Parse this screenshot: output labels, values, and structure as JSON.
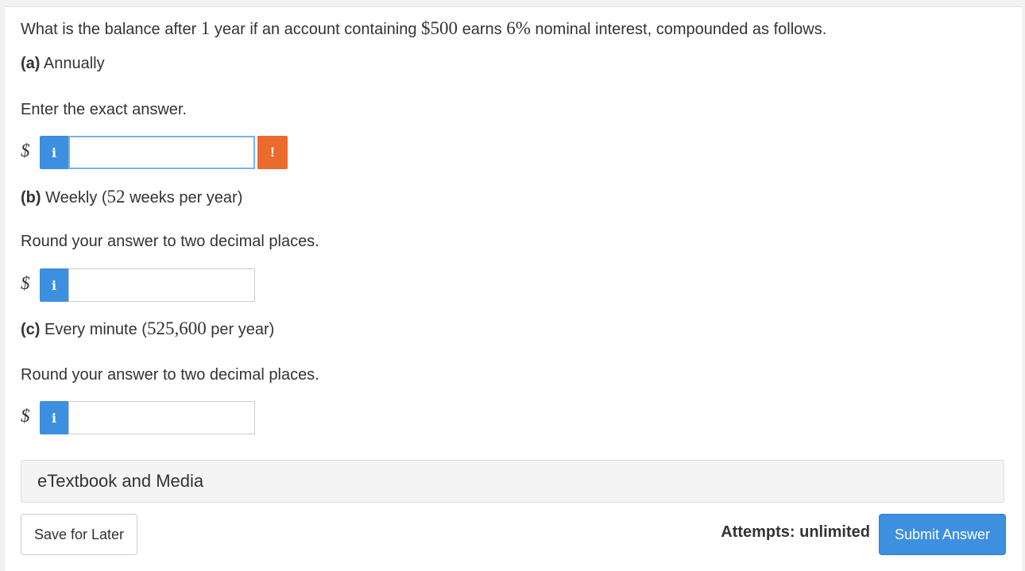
{
  "question": {
    "intro": {
      "pre1": "What is the balance after ",
      "years": "1",
      "pre2": " year if an account containing ",
      "principal": "$500",
      "pre3": " earns ",
      "rate": "6%",
      "post": " nominal interest, compounded as follows."
    }
  },
  "parts": [
    {
      "tag": "(a)",
      "label": "Annually",
      "instruction": "Enter the exact answer.",
      "currency": "$",
      "info_icon": "i",
      "value": "",
      "warning_icon": "!"
    },
    {
      "tag": "(b)",
      "label_pre": "Weekly (",
      "label_math": "52",
      "label_post": " weeks per year)",
      "instruction": "Round your answer to two decimal places.",
      "currency": "$",
      "info_icon": "i",
      "value": ""
    },
    {
      "tag": "(c)",
      "label_pre": "Every minute (",
      "label_math": "525,600",
      "label_post": " per year)",
      "instruction": "Round your answer to two decimal places.",
      "currency": "$",
      "info_icon": "i",
      "value": ""
    }
  ],
  "etextbook": {
    "label": "eTextbook and Media"
  },
  "footer": {
    "save_label": "Save for Later",
    "attempts_label": "Attempts: unlimited",
    "submit_label": "Submit Answer"
  },
  "colors": {
    "accent": "#3d8fe0",
    "warning": "#eb6a2e"
  }
}
